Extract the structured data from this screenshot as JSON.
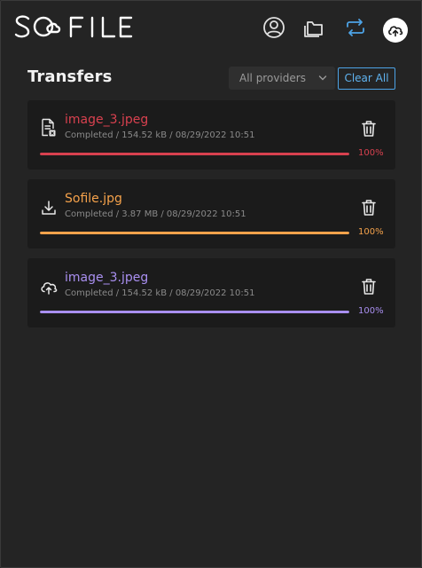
{
  "app": {
    "logo_text": "SOFILE"
  },
  "header": {
    "icons": [
      "user-circle-icon",
      "folder-icon",
      "transfer-icon",
      "upload-cloud-icon"
    ],
    "active_color": "#4da3e6"
  },
  "toolbar": {
    "title": "Transfers",
    "provider_select": "All providers",
    "clear_label": "Clear All"
  },
  "transfers": [
    {
      "name": "image_3.jpeg",
      "meta": "Completed / 154.52 kB / 08/29/2022 10:51",
      "progress": 100,
      "progress_label": "100%",
      "color": "#d8414f",
      "icon": "file-error-icon"
    },
    {
      "name": "Sofile.jpg",
      "meta": "Completed / 3.87 MB / 08/29/2022 10:51",
      "progress": 100,
      "progress_label": "100%",
      "color": "#f5a24b",
      "icon": "download-icon"
    },
    {
      "name": "image_3.jpeg",
      "meta": "Completed / 154.52 kB / 08/29/2022 10:51",
      "progress": 100,
      "progress_label": "100%",
      "color": "#a98ff0",
      "icon": "upload-icon"
    }
  ]
}
